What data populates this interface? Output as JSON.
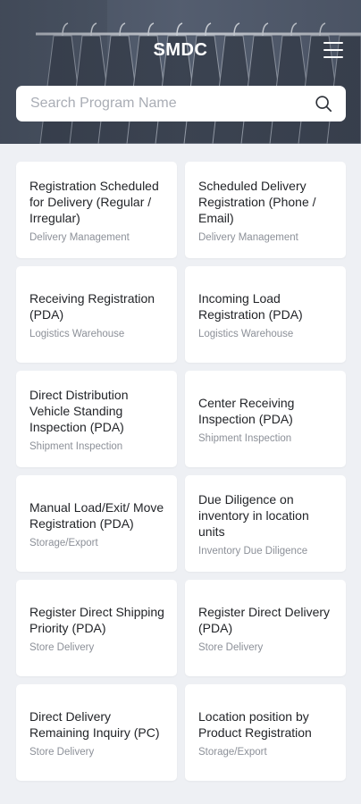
{
  "header": {
    "title": "SMDC",
    "menu_icon": "hamburger-menu-icon"
  },
  "search": {
    "placeholder": "Search Program Name",
    "icon": "search-icon"
  },
  "cards": [
    {
      "title": "Registration Scheduled for Delivery (Regular / Irregular)",
      "category": "Delivery Management"
    },
    {
      "title": "Scheduled Delivery Registration (Phone / Email)",
      "category": "Delivery Management"
    },
    {
      "title": "Receiving Registration (PDA)",
      "category": "Logistics Warehouse"
    },
    {
      "title": "Incoming Load Registration (PDA)",
      "category": "Logistics Warehouse"
    },
    {
      "title": "Direct Distribution Vehicle Standing Inspection (PDA)",
      "category": "Shipment Inspection"
    },
    {
      "title": "Center Receiving Inspection (PDA)",
      "category": "Shipment Inspection"
    },
    {
      "title": "Manual Load/Exit/ Move Registration (PDA)",
      "category": "Storage/Export"
    },
    {
      "title": "Due Diligence on inventory in location units",
      "category": "Inventory Due Diligence"
    },
    {
      "title": "Register Direct Shipping Priority (PDA)",
      "category": "Store Delivery"
    },
    {
      "title": "Register Direct Delivery (PDA)",
      "category": "Store Delivery"
    },
    {
      "title": "Direct Delivery Remaining Inquiry (PC)",
      "category": "Store Delivery"
    },
    {
      "title": "Location position by Product Registration",
      "category": "Storage/Export"
    }
  ]
}
